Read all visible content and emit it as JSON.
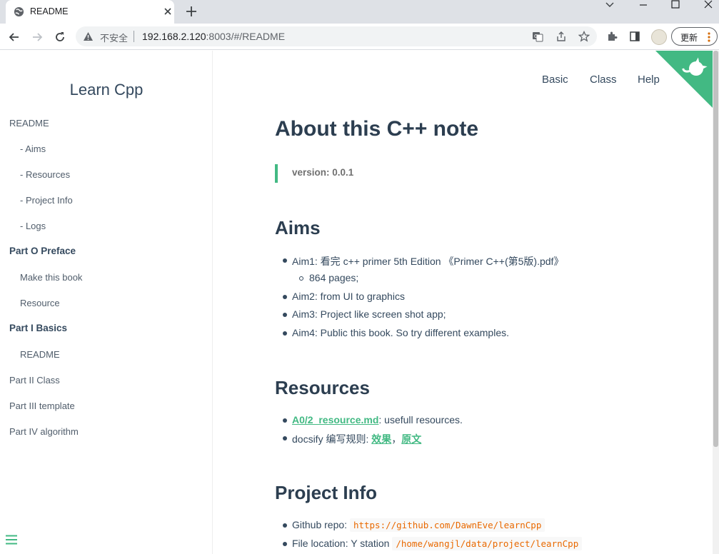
{
  "browser": {
    "tab_title": "README",
    "insecure_label": "不安全",
    "url_host": "192.168.2.120",
    "url_rest": ":8003/#/README",
    "update_label": "更新"
  },
  "sidebar": {
    "app_name": "Learn Cpp",
    "items": [
      {
        "label": "README"
      },
      {
        "label": "- Aims"
      },
      {
        "label": "- Resources"
      },
      {
        "label": "- Project Info"
      },
      {
        "label": "- Logs"
      },
      {
        "label": "Part O Preface"
      },
      {
        "label": "Make this book"
      },
      {
        "label": "Resource"
      },
      {
        "label": "Part I Basics"
      },
      {
        "label": "README"
      },
      {
        "label": "Part II Class"
      },
      {
        "label": "Part III template"
      },
      {
        "label": "Part IV algorithm"
      }
    ]
  },
  "topnav": {
    "basic": "Basic",
    "class": "Class",
    "help": "Help"
  },
  "main": {
    "title": "About this C++ note",
    "version": "version: 0.0.1",
    "aims": {
      "heading": "Aims",
      "items": [
        "Aim1: 看完 c++ primer 5th Edition 《Primer C++(第5版).pdf》",
        "864 pages;",
        "Aim2: from UI to graphics",
        "Aim3: Project like screen shot app;",
        "Aim4: Public this book. So try different examples."
      ]
    },
    "resources": {
      "heading": "Resources",
      "link1": "A0/2_resource.md",
      "link1_suffix": ": usefull resources.",
      "docsify_prefix": "docsify 编写规则: ",
      "link2": "效果",
      "comma": "，",
      "link3": "原文"
    },
    "project_info": {
      "heading": "Project Info",
      "repo_label": "Github repo:",
      "repo_url": "https://github.com/DawnEve/learnCpp",
      "file_label": "File location: Y station",
      "file_path": "/home/wangjl/data/project/learnCpp"
    }
  },
  "colors": {
    "accent": "#42b983",
    "text": "#34495e",
    "code": "#e96900"
  }
}
